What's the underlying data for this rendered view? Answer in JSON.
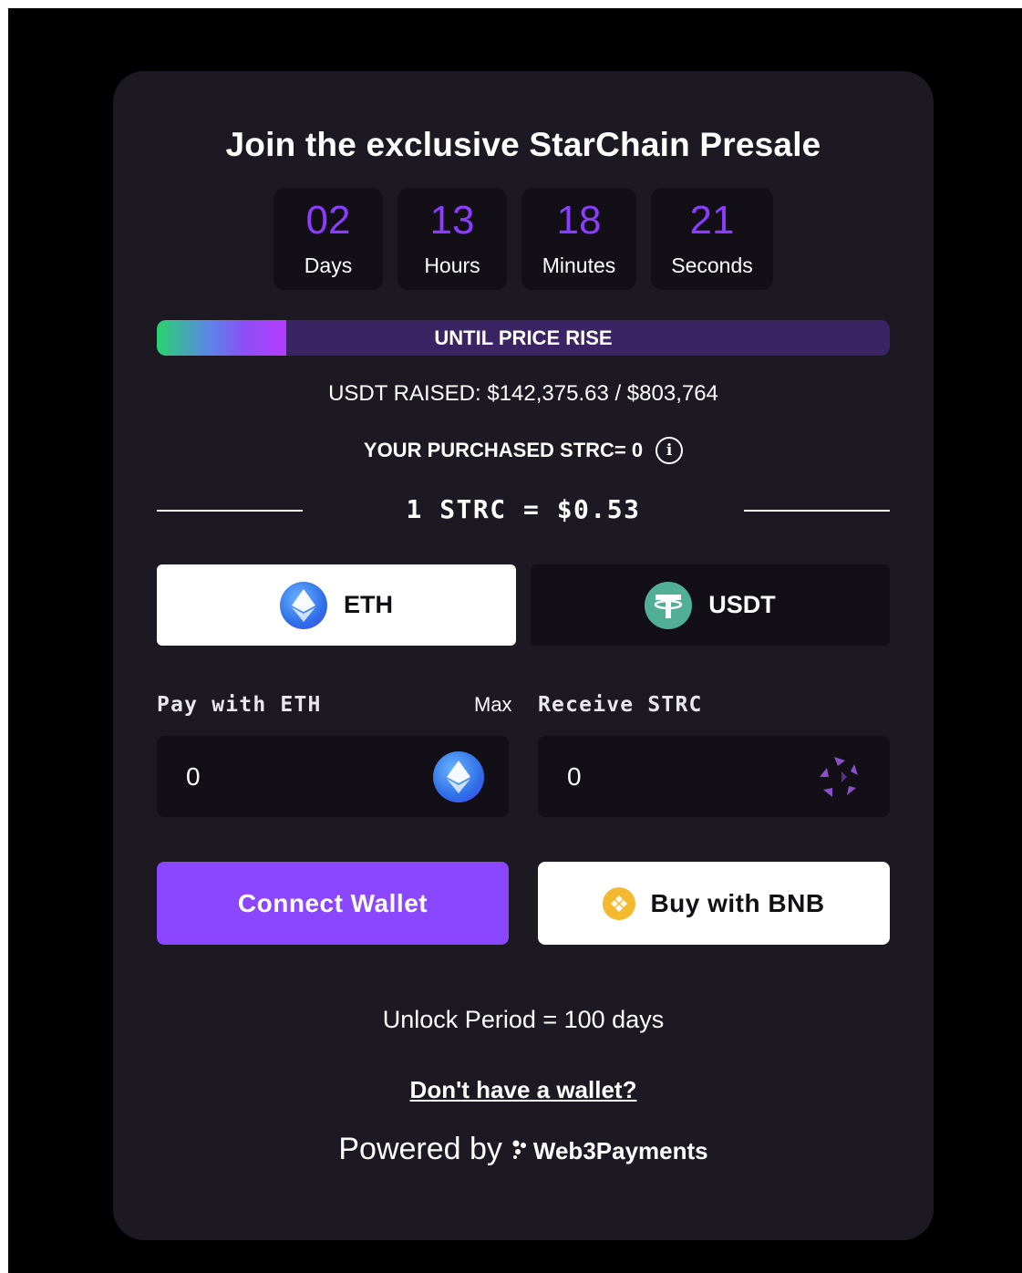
{
  "title": "Join the exclusive StarChain Presale",
  "countdown": [
    {
      "value": "02",
      "label": "Days"
    },
    {
      "value": "13",
      "label": "Hours"
    },
    {
      "value": "18",
      "label": "Minutes"
    },
    {
      "value": "21",
      "label": "Seconds"
    }
  ],
  "progress": {
    "label": "UNTIL PRICE RISE",
    "fraction": 0.177
  },
  "raised_text": "USDT RAISED: $142,375.63 / $803,764",
  "purchased_text": "YOUR PURCHASED STRC= 0",
  "rate_text": "1 STRC = $0.53",
  "tabs": {
    "eth": "ETH",
    "usdt": "USDT",
    "selected": "ETH"
  },
  "pay": {
    "label": "Pay with ETH",
    "max_label": "Max",
    "value": "0"
  },
  "receive": {
    "label": "Receive STRC",
    "value": "0"
  },
  "buttons": {
    "connect": "Connect Wallet",
    "bnb": "Buy with BNB"
  },
  "unlock_text": "Unlock Period = 100 days",
  "no_wallet_text": "Don't have a wallet?",
  "powered": {
    "prefix": "Powered by",
    "brand": "Web3Payments"
  },
  "colors": {
    "accent": "#8b46ff",
    "card": "#1c1922",
    "panel": "#121016",
    "usdt": "#50af95",
    "bnb": "#f3ba2f"
  },
  "icons": {
    "info": "info-icon",
    "eth": "ethereum-icon",
    "usdt": "tether-icon",
    "strc": "starchain-logo-icon",
    "bnb": "bnb-icon",
    "brand": "web3payments-logo-icon"
  }
}
